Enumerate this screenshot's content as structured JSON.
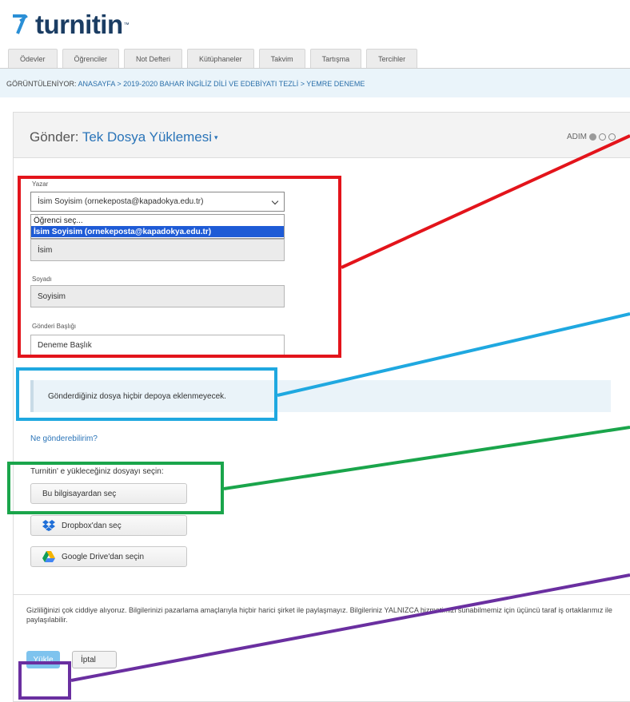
{
  "brand": {
    "name": "turnitin",
    "trademark": "™"
  },
  "tabs": [
    "Ödevler",
    "Öğrenciler",
    "Not Defteri",
    "Kütüphaneler",
    "Takvim",
    "Tartışma",
    "Tercihler"
  ],
  "breadcrumb": {
    "lead": "GÖRÜNTÜLENİYOR: ",
    "path": "ANASAYFA > 2019-2020 BAHAR İNGİLİZ DİLİ VE EDEBİYATI TEZLİ > YEMRE DENEME"
  },
  "header": {
    "title": "Gönder: ",
    "subtitle": "Tek Dosya Yüklemesi",
    "step_label": "ADIM"
  },
  "form": {
    "author_label": "Yazar",
    "author_selected": "İsim Soyisim (ornekeposta@kapadokya.edu.tr)",
    "author_options": [
      "Öğrenci seç...",
      "İsim Soyisim (ornekeposta@kapadokya.edu.tr)"
    ],
    "first_name_value": "İsim",
    "last_name_label": "Soyadı",
    "last_name_value": "Soyisim",
    "title_label": "Gönderi Başlığı",
    "title_value": "Deneme Başlık"
  },
  "info_message": "Gönderdiğiniz dosya hiçbir depoya eklenmeyecek.",
  "help_link": "Ne gönderebilirim?",
  "upload": {
    "prompt": "Turnitin' e yükleceğiniz dosyayı seçin:",
    "computer_button": "Bu bilgisayardan seç",
    "dropbox_button": "Dropbox'dan seç",
    "gdrive_button": "Google Drive'dan seçin"
  },
  "privacy_text": "Gizliliğinizi çok ciddiye alıyoruz. Bilgilerinizi pazarlama amaçlarıyla hiçbir harici şirket ile paylaşmayız. Bilgileriniz YALNIZCA hizmetimizi sunabilmemiz için üçüncü taraf iş ortaklarımız ile paylaşılabilir.",
  "actions": {
    "upload": "Yükle",
    "cancel": "İptal"
  },
  "colors": {
    "brand": "#1b3d63",
    "link": "#2a74b8",
    "annotation_red": "#e3141b",
    "annotation_blue": "#1fa8e0",
    "annotation_green": "#1aa54b",
    "annotation_purple": "#6a2fa0"
  }
}
